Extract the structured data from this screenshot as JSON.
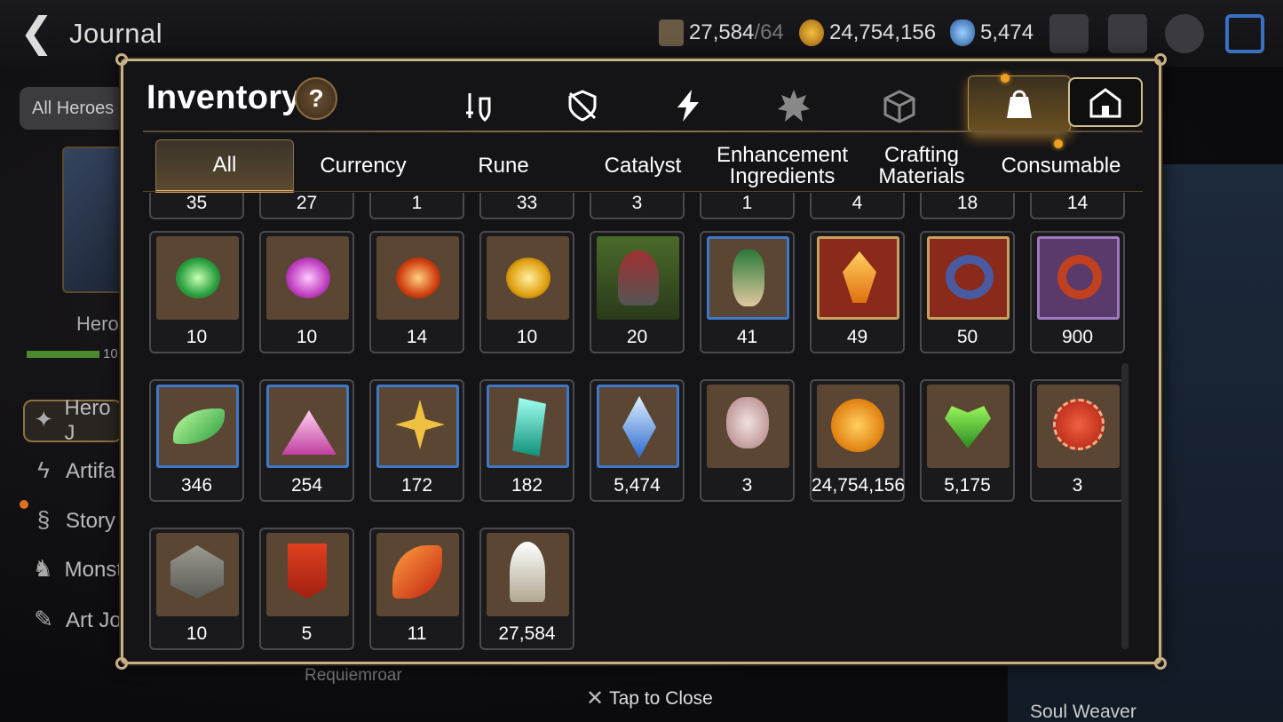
{
  "header": {
    "back_label": "Journal",
    "stone": "27,584",
    "stone_max": "/64",
    "gold": "24,754,156",
    "skystone": "5,474"
  },
  "sidebar": {
    "filter": "All Heroes",
    "hero_label": "Hero",
    "hero_count": "10",
    "items": [
      "Hero J",
      "Artifa",
      "Story",
      "Monst",
      "Art Jo"
    ]
  },
  "background": {
    "requiem": "Requiemroar",
    "soul": "Soul Weaver"
  },
  "inventory": {
    "title": "Inventory",
    "help": "?",
    "category_icons": [
      "equipment-icon",
      "shield-icon",
      "lightning-icon",
      "ghost-icon",
      "cube-icon",
      "bag-icon",
      "house-icon"
    ],
    "sub_tabs": [
      "All",
      "Currency",
      "Rune",
      "Catalyst",
      "Enhancement Ingredients",
      "Crafting Materials",
      "Consumable"
    ],
    "row0_partial": [
      "35",
      "27",
      "1",
      "33",
      "3",
      "1",
      "4",
      "18",
      "14"
    ],
    "items_row1": [
      "10",
      "10",
      "14",
      "10",
      "20",
      "41",
      "49",
      "50",
      "900"
    ],
    "items_row2": [
      "346",
      "254",
      "172",
      "182",
      "5,474",
      "3",
      "24,754,156",
      "5,175",
      "3"
    ],
    "items_row3": [
      "10",
      "5",
      "11",
      "27,584"
    ]
  },
  "footer": {
    "close": "Tap to Close"
  }
}
